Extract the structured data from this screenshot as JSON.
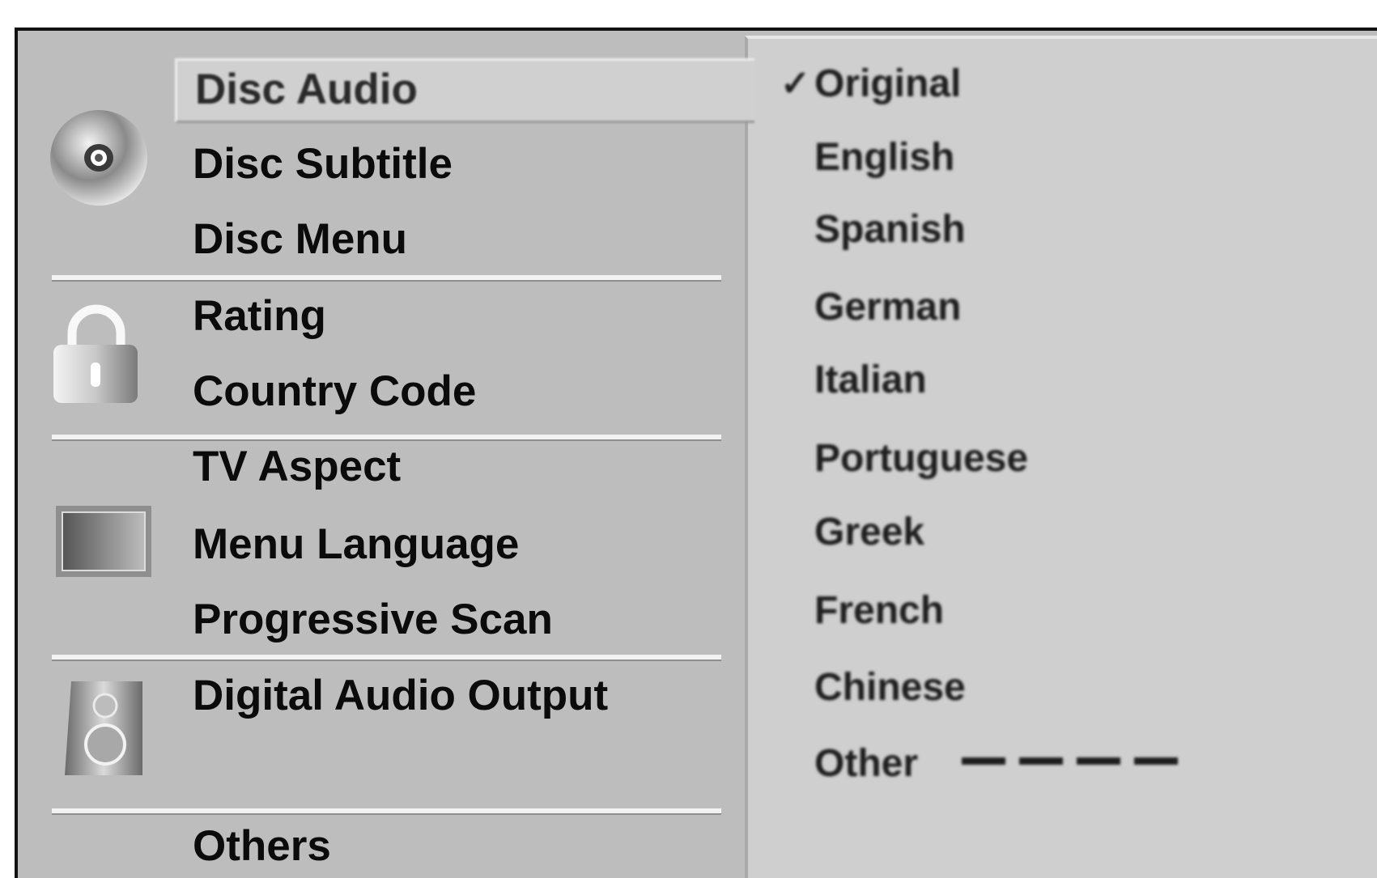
{
  "menu": {
    "items": [
      {
        "label": "Disc Audio",
        "selected": true
      },
      {
        "label": "Disc Subtitle"
      },
      {
        "label": "Disc Menu"
      },
      {
        "label": "Rating"
      },
      {
        "label": "Country Code"
      },
      {
        "label": "TV Aspect"
      },
      {
        "label": "Menu Language"
      },
      {
        "label": "Progressive Scan"
      },
      {
        "label": "Digital Audio Output"
      },
      {
        "label": "Others"
      }
    ],
    "icons": [
      "disc-icon",
      "lock-icon",
      "tv-icon",
      "speaker-icon"
    ]
  },
  "options": {
    "check_mark": "✓",
    "items": [
      "Original",
      "English",
      "Spanish",
      "German",
      "Italian",
      "Portuguese",
      "Greek",
      "French",
      "Chinese",
      "Other"
    ],
    "selected_index": 0
  },
  "colors": {
    "panel": "#bdbdbd",
    "sub_panel": "#cfcfcf",
    "text": "#0b0b0b"
  }
}
